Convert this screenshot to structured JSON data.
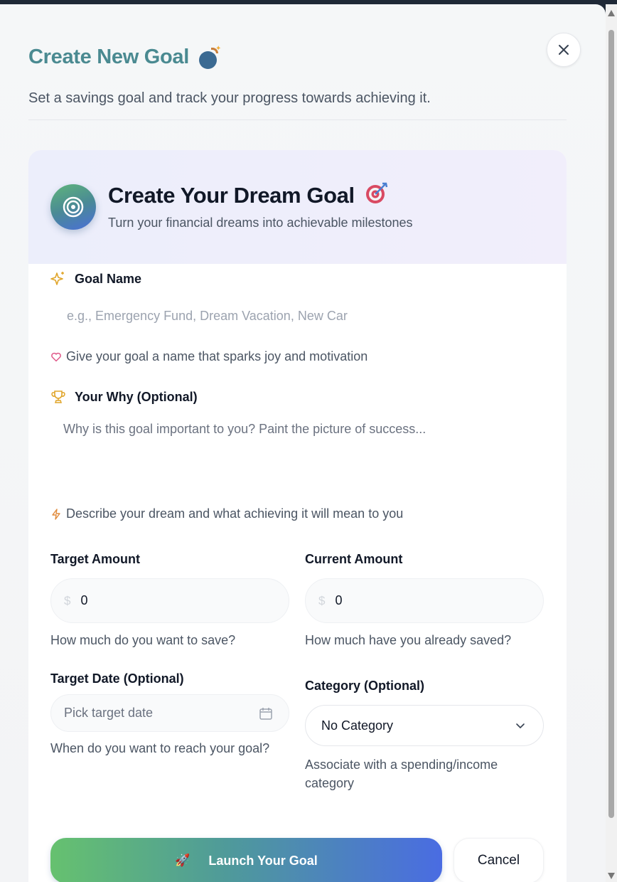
{
  "dialog": {
    "title": "Create New Goal",
    "title_icon": "bomb-icon",
    "subtitle": "Set a savings goal and track your progress towards achieving it.",
    "close_icon": "close-icon"
  },
  "card": {
    "title": "Create Your Dream Goal",
    "title_emoji": "🎯",
    "subtitle": "Turn your financial dreams into achievable milestones"
  },
  "form": {
    "goal_name": {
      "label": "Goal Name",
      "placeholder": "e.g., Emergency Fund, Dream Vacation, New Car",
      "hint": "Give your goal a name that sparks joy and motivation"
    },
    "why": {
      "label": "Your Why (Optional)",
      "placeholder": "Why is this goal important to you? Paint the picture of success...",
      "hint": "Describe your dream and what achieving it will mean to you"
    },
    "target_amount": {
      "label": "Target Amount",
      "currency": "$",
      "value": "0",
      "hint": "How much do you want to save?"
    },
    "current_amount": {
      "label": "Current Amount",
      "currency": "$",
      "value": "0",
      "hint": "How much have you already saved?"
    },
    "target_date": {
      "label": "Target Date (Optional)",
      "placeholder": "Pick target date",
      "hint": "When do you want to reach your goal?"
    },
    "category": {
      "label": "Category (Optional)",
      "selected": "No Category",
      "hint": "Associate with a spending/income category"
    }
  },
  "actions": {
    "launch_emoji": "🚀",
    "launch_label": "Launch Your Goal",
    "cancel_label": "Cancel"
  },
  "colors": {
    "title": "#4a8a91",
    "accent_gradient_start": "#66c16f",
    "accent_gradient_end": "#4a6ce2"
  }
}
